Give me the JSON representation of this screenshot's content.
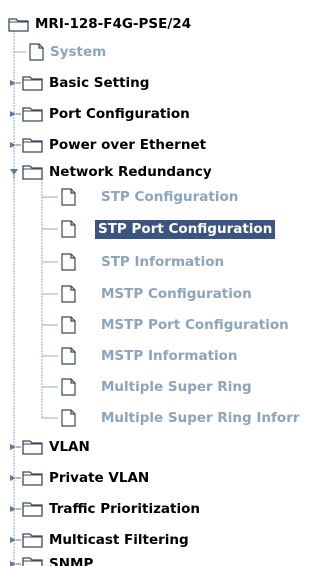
{
  "tree": {
    "root": {
      "label": "MRI-128-F4G-PSE/24",
      "icon": "folder-open-icon"
    },
    "items": [
      {
        "label": "System",
        "icon": "document-icon",
        "style": "link"
      },
      {
        "label": "Basic Setting",
        "icon": "folder-icon",
        "style": "dark",
        "expander": "collapsed"
      },
      {
        "label": "Port Configuration",
        "icon": "folder-icon",
        "style": "dark",
        "expander": "collapsed"
      },
      {
        "label": "Power over Ethernet",
        "icon": "folder-icon",
        "style": "dark",
        "expander": "collapsed"
      },
      {
        "label": "Network Redundancy",
        "icon": "folder-open-icon",
        "style": "dark",
        "expander": "expanded"
      }
    ],
    "network_redundancy_children": [
      {
        "label": "STP Configuration",
        "icon": "document-icon",
        "style": "link"
      },
      {
        "label": "STP Port Configuration",
        "icon": "document-icon",
        "style": "selected"
      },
      {
        "label": "STP Information",
        "icon": "document-icon",
        "style": "link"
      },
      {
        "label": "MSTP Configuration",
        "icon": "document-icon",
        "style": "link"
      },
      {
        "label": "MSTP Port Configuration",
        "icon": "document-icon",
        "style": "link"
      },
      {
        "label": "MSTP Information",
        "icon": "document-icon",
        "style": "link"
      },
      {
        "label": "Multiple Super Ring",
        "icon": "document-icon",
        "style": "link"
      },
      {
        "label": "Multiple Super Ring Inforr",
        "icon": "document-icon",
        "style": "link"
      }
    ],
    "bottom_items": [
      {
        "label": "VLAN",
        "icon": "folder-icon",
        "style": "dark",
        "expander": "collapsed"
      },
      {
        "label": "Private VLAN",
        "icon": "folder-icon",
        "style": "dark",
        "expander": "collapsed"
      },
      {
        "label": "Traffic Prioritization",
        "icon": "folder-icon",
        "style": "dark",
        "expander": "collapsed"
      },
      {
        "label": "Multicast Filtering",
        "icon": "folder-icon",
        "style": "dark",
        "expander": "collapsed"
      },
      {
        "label": "SNMP",
        "icon": "folder-icon",
        "style": "dark",
        "expander": "collapsed"
      }
    ]
  },
  "colors": {
    "text_dark": "#000000",
    "text_link": "#8ca5bd",
    "selected_bg": "#3c5580",
    "selected_text": "#ffffff",
    "connector": "#9aa8b8",
    "folder_fill": "#ffffff",
    "folder_stroke": "#3b4a5c",
    "toggle_color": "#5a7aa0"
  }
}
